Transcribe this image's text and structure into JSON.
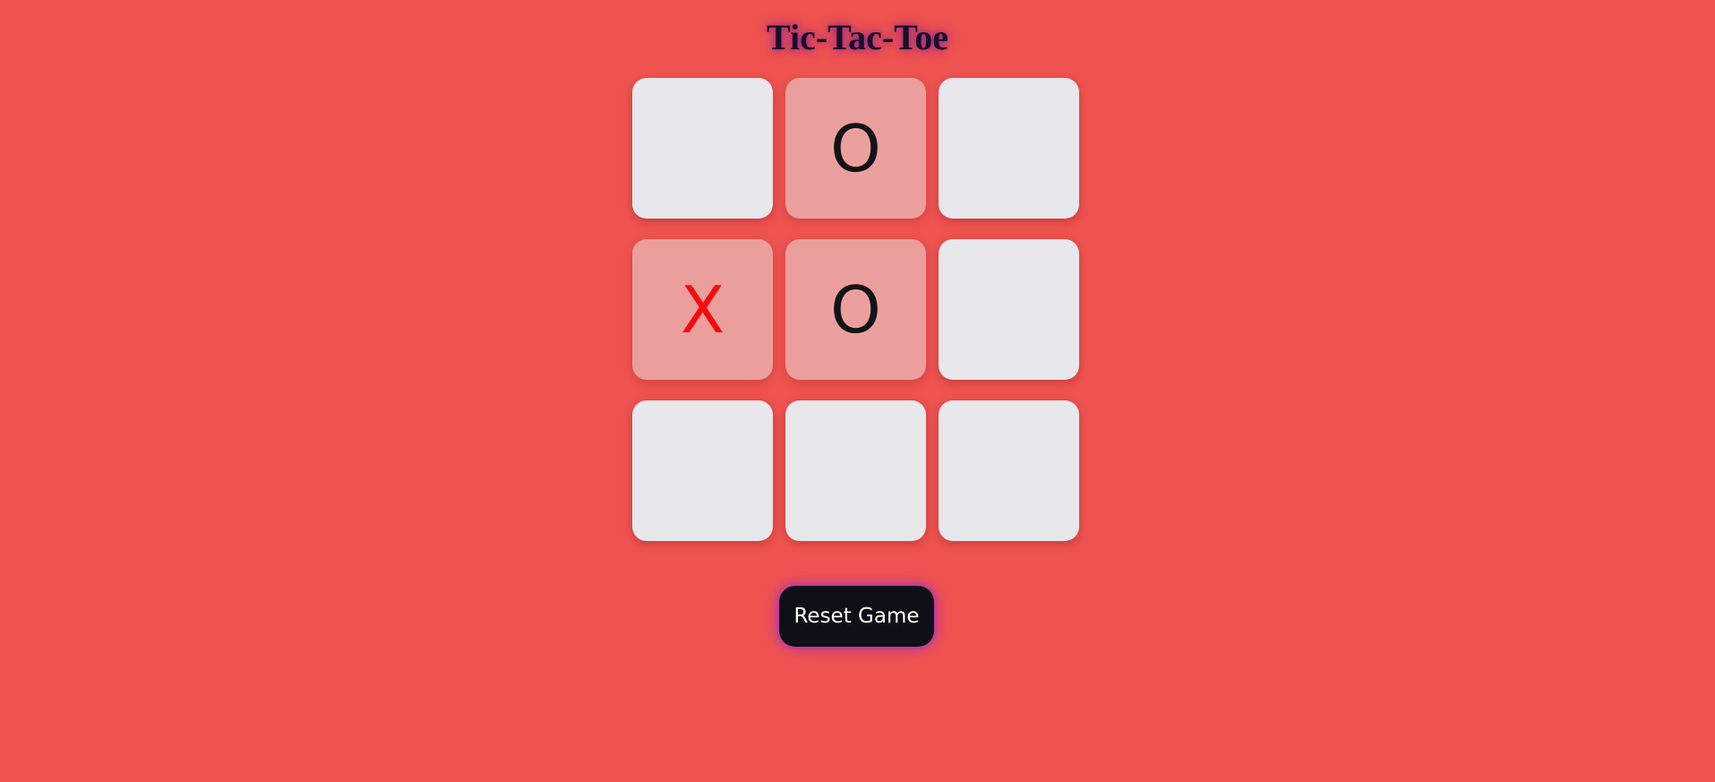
{
  "title": "Tic-Tac-Toe",
  "board": {
    "cells": [
      "",
      "O",
      "",
      "X",
      "O",
      "",
      "",
      "",
      ""
    ]
  },
  "reset_label": "Reset Game",
  "colors": {
    "background": "#ef5350",
    "x_mark": "#f30d0d",
    "o_mark": "#111316",
    "empty_cell": "#e8e7ec",
    "filled_cell": "#eb9f9d",
    "button": "#0d1117"
  }
}
